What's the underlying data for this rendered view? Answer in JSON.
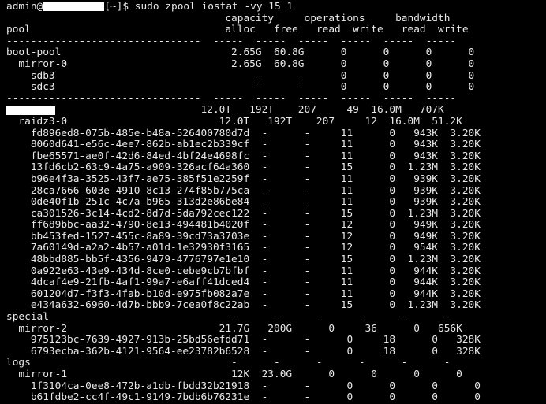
{
  "colors": {
    "background": "#000000",
    "foreground": "#e8e8e8",
    "redaction": "#ffffff"
  },
  "prompt": {
    "user": "admin@",
    "suffix": "[~]$ ",
    "command": "sudo zpool iostat -vy 15 1"
  },
  "header": {
    "group_row": "                                    capacity     operations     bandwidth",
    "column_row": "pool                                alloc   free   read  write   read  write",
    "separator": "--------------------------------  -----  -----  -----  -----  -----  -----"
  },
  "section_boot": [
    "boot-pool                            2.65G  60.8G      0      0      0      0",
    "  mirror-0                           2.65G  60.8G      0      0      0      0",
    "    sdb3                                 -      -      0      0      0      0",
    "    sdc3                                 -      -      0      0      0      0"
  ],
  "separator_2": "--------------------------------  -----  -----  -----  -----  -----  -----",
  "data_pool": {
    "stats": "                                12.0T   192T    207     49  16.0M   707K"
  },
  "section_data": [
    "  raidz3-0                         12.0T   192T    207     12  16.0M  51.2K",
    "    fd896ed8-075b-485e-b48a-526400780d7d  -      -     11      0   943K  3.20K",
    "    8060d641-e56c-4ee7-862b-ab1ec2b339cf  -      -     11      0   943K  3.20K",
    "    fbe65571-ae0f-42d6-84ed-4bf24e4698fc  -      -     11      0   943K  3.20K",
    "    13fd6cb2-63c9-4a75-a909-326acf64a360  -      -     15      0  1.23M  3.20K",
    "    b96e4f3a-3525-43f7-ae75-385f51e2259f  -      -     11      0   939K  3.20K",
    "    28ca7666-603e-4910-8c13-274f85b775ca  -      -     11      0   939K  3.20K",
    "    0de40f1b-251c-4c7a-b965-313d2e86be84  -      -     11      0   939K  3.20K",
    "    ca301526-3c14-4cd2-8d7d-5da792cec122  -      -     15      0  1.23M  3.20K",
    "    ff689bbc-aa32-4790-8e13-494481b4020f  -      -     12      0   949K  3.20K",
    "    bb453fed-1527-455c-8a89-39cd73a3703e  -      -     12      0   949K  3.20K",
    "    7a60149d-a2a2-4b57-a01d-1e32930f3165  -      -     12      0   954K  3.20K",
    "    48bbd885-bb5f-4356-9479-4776797e1e10  -      -     15      0  1.23M  3.20K",
    "    0a922e63-43e9-434d-8ce0-cebe9cb7bfbf  -      -     11      0   944K  3.20K",
    "    4dcaf4e9-21fb-4af1-99a7-e6aff41dced4  -      -     11      0   944K  3.20K",
    "    601204d7-f3f3-4fab-b10d-e975fb082a7e  -      -     11      0   944K  3.20K",
    "    e434a632-6960-4d7b-bbb9-7cea0f8c22ab  -      -     15      0  1.23M  3.20K"
  ],
  "section_special": [
    "special                              -      -      -      -      -      -",
    "  mirror-2                         21.7G   200G      0     36      0   656K",
    "    975123bc-7639-4927-913b-25bd56efdd71  -      -      0     18      0   328K",
    "    6793ecba-362b-4121-9564-ee23782b6528  -      -      0     18      0   328K"
  ],
  "section_logs": [
    "logs                                 -      -      -      -      -      -",
    "  mirror-1                           12K  23.0G      0      0      0      0",
    "    1f3104ca-0ee8-472b-a1db-fbdd32b21918  -      -      0      0      0      0",
    "    b61fdbe2-cc4f-49c1-9149-7bdb6b76231e  -      -      0      0      0      0"
  ]
}
